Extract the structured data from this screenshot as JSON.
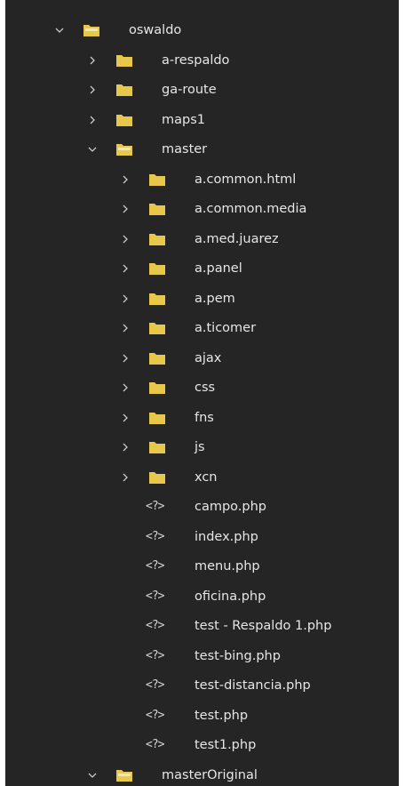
{
  "explorer": {
    "root": {
      "name": "oswaldo",
      "children": [
        {
          "name": "a-respaldo",
          "type": "folder",
          "expanded": false
        },
        {
          "name": "ga-route",
          "type": "folder",
          "expanded": false
        },
        {
          "name": "maps1",
          "type": "folder",
          "expanded": false
        },
        {
          "name": "master",
          "type": "folder",
          "expanded": true,
          "children": [
            {
              "name": "a.common.html",
              "type": "folder"
            },
            {
              "name": "a.common.media",
              "type": "folder"
            },
            {
              "name": "a.med.juarez",
              "type": "folder"
            },
            {
              "name": "a.panel",
              "type": "folder"
            },
            {
              "name": "a.pem",
              "type": "folder"
            },
            {
              "name": "a.ticomer",
              "type": "folder"
            },
            {
              "name": "ajax",
              "type": "folder"
            },
            {
              "name": "css",
              "type": "folder"
            },
            {
              "name": "fns",
              "type": "folder"
            },
            {
              "name": "js",
              "type": "folder"
            },
            {
              "name": "xcn",
              "type": "folder"
            },
            {
              "name": "campo.php",
              "type": "file"
            },
            {
              "name": "index.php",
              "type": "file"
            },
            {
              "name": "menu.php",
              "type": "file"
            },
            {
              "name": "oficina.php",
              "type": "file"
            },
            {
              "name": "test - Respaldo 1.php",
              "type": "file"
            },
            {
              "name": "test-bing.php",
              "type": "file"
            },
            {
              "name": "test-distancia.php",
              "type": "file"
            },
            {
              "name": "test.php",
              "type": "file"
            },
            {
              "name": "test1.php",
              "type": "file"
            }
          ]
        },
        {
          "name": "masterOriginal",
          "type": "folder",
          "expanded": true
        }
      ]
    },
    "php_icon_glyph": "<?>",
    "colors": {
      "panel_bg": "#252526",
      "text": "#e6e6e6",
      "folder": "#e8c84a",
      "chevron": "#c8c8c8"
    }
  }
}
